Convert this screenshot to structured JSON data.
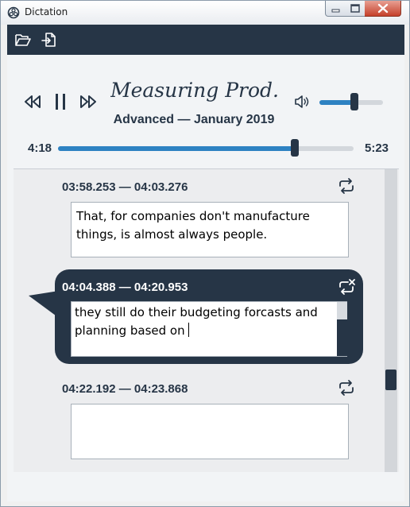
{
  "window": {
    "title": "Dictation",
    "icon": "app-dictation-icon"
  },
  "toolbar": {
    "open_icon": "folder-open-icon",
    "export_icon": "export-file-icon"
  },
  "player": {
    "rewind_icon": "rewind-icon",
    "pause_icon": "pause-icon",
    "forward_icon": "fast-forward-icon",
    "title": "Measuring Prod...",
    "subtitle": "Advanced — January 2019",
    "volume_icon": "speaker-icon",
    "volume_level": 0.55,
    "elapsed": "4:18",
    "total": "5:23",
    "progress": 0.8
  },
  "segments": [
    {
      "time": "03:58.253 — 04:03.276",
      "text": "That, for companies don't manufacture things, is almost always people.",
      "active": false
    },
    {
      "time": "04:04.388 — 04:20.953",
      "text": "they still do their budgeting forcasts and planning based on",
      "active": true
    },
    {
      "time": "04:22.192 — 04:23.868",
      "text": "",
      "active": false
    }
  ],
  "colors": {
    "navy": "#263546",
    "accent": "#2e82c2"
  }
}
